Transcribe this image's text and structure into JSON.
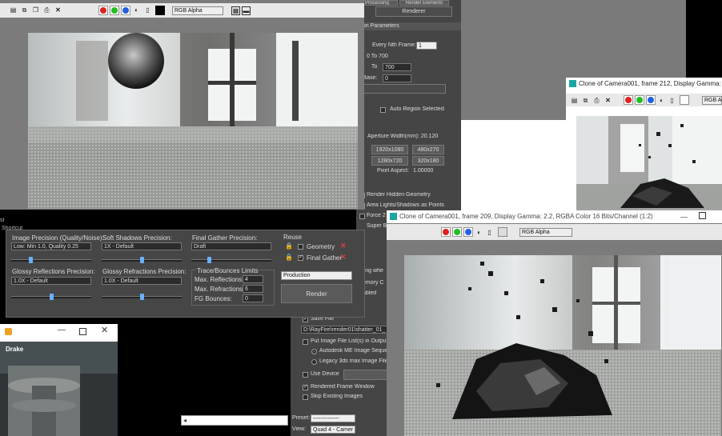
{
  "main_vfb": {
    "channel": "RGB Alpha",
    "colors": {
      "red": "#e02020",
      "green": "#20c020",
      "blue": "#2060e0"
    }
  },
  "render_setup": {
    "tabs": [
      "Processing",
      "Render Elements",
      "Renderer"
    ],
    "section_title": "mon Parameters",
    "every_nth_label": "Every Nth Frame:",
    "every_nth_value": "1",
    "range_text": "0 To 700",
    "to_label": "To",
    "to_value": "700",
    "base_label": "r Base:",
    "base_value": "0",
    "auto_region": "Auto Region Selected",
    "aperture": "Aperture Width(mm): 20.120",
    "res_buttons": [
      "1920x1080",
      "480x270",
      "1280x720",
      "320x180"
    ],
    "pixel_aspect_label": "Pixel Aspect:",
    "pixel_aspect_value": "1.00000",
    "render_hidden": "Render Hidden Geometry",
    "area_lights": "Area Lights/Shadows as Points",
    "force": "Force 2",
    "super": "Super B",
    "video_color": "Video Color Check",
    "lighting": "ghting whe",
    "memory": "emory C",
    "enabled": "abled",
    "save_file": "Save File",
    "file_path": "D:\\RayFire\\render01\\shatter_01_",
    "put_image_list": "Put Image File List(s) in Output P",
    "autodesk_me": "Autodesk ME Image Sequen",
    "legacy": "Legacy 3ds max Image File L",
    "use_device": "Use Device",
    "rendered_frame": "Rendered Frame Window",
    "skip_existing": "Skip Existing Images",
    "preset_label": "Preset:",
    "preset_value": "--------------",
    "view_label": "View:",
    "view_value": "Quad 4 - Camer"
  },
  "quality_panel": {
    "image_precision_label": "Image Precision (Quality/Noise):",
    "image_precision_value": "Low: Min 1.0, Quality 0.25",
    "soft_shadows_label": "Soft Shadows Precision:",
    "soft_shadows_value": "1X - Default",
    "final_gather_label": "Final Gather Precision:",
    "final_gather_value": "Draft",
    "reuse_label": "Reuse",
    "geometry_label": "Geometry",
    "final_gather_reuse_label": "Final Gather",
    "glossy_reflections_label": "Glossy Reflections Precision:",
    "glossy_reflections_value": "1.0X - Default",
    "glossy_refractions_label": "Glossy Refractions Precision:",
    "glossy_refractions_value": "1.0X - Default",
    "trace_label": "Trace/Bounces Limits",
    "max_reflections_label": "Max. Reflections:",
    "max_reflections_value": "4",
    "max_refractions_label": "Max. Refractions:",
    "max_refractions_value": "6",
    "fg_bounces_label": "FG Bounces:",
    "fg_bounces_value": "0",
    "mode_value": "Production",
    "render_button": "Render"
  },
  "clone212": {
    "title": "Clone of Camera001, frame 212, Display Gamma: 2.2,",
    "channel": "RGB Alph"
  },
  "clone209": {
    "title": "Clone of Camera001, frame 209, Display Gamma: 2.2, RGBA Color 16 Bits/Channel (1:2)",
    "channel": "RGB Alpha"
  },
  "drake": {
    "title": "Drake"
  },
  "side_labels": {
    "a": "3ds",
    "b": "Shortcut",
    "c": "st"
  }
}
